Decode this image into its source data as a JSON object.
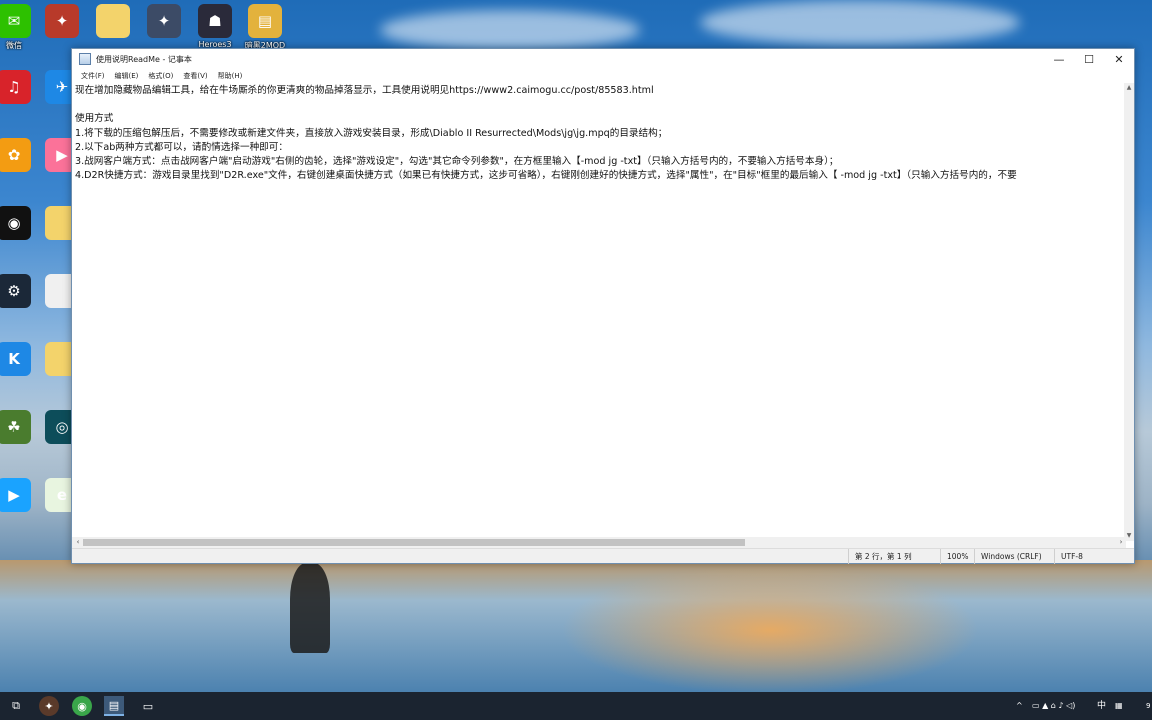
{
  "desktop": {
    "icons": [
      {
        "label": "微信",
        "icon": "wechat-icon",
        "color": "#2dc100",
        "glyph": "✉"
      },
      {
        "label": "",
        "icon": "game-icon",
        "color": "#b83a2a",
        "glyph": "✦"
      },
      {
        "label": "",
        "icon": "folder-icon",
        "color": "#f3d36b",
        "glyph": ""
      },
      {
        "label": "",
        "icon": "game-icon",
        "color": "#3c4b66",
        "glyph": "✦"
      },
      {
        "label": "Heroes3",
        "icon": "game-icon",
        "color": "#2a2a3a",
        "glyph": "☗"
      },
      {
        "label": "暗黑2MOD",
        "icon": "archive-icon",
        "color": "#e3b23c",
        "glyph": "▤"
      },
      {
        "label": "",
        "icon": "netease-music-icon",
        "color": "#d8232a",
        "glyph": "♫"
      },
      {
        "label": "",
        "icon": "app-icon",
        "color": "#1e88e5",
        "glyph": "✈"
      },
      {
        "label": "",
        "icon": "app-icon",
        "color": "#f39c12",
        "glyph": "✿"
      },
      {
        "label": "",
        "icon": "bilibili-icon",
        "color": "#fb7299",
        "glyph": "▶"
      },
      {
        "label": "",
        "icon": "qq-icon",
        "color": "#111",
        "glyph": "◉"
      },
      {
        "label": "",
        "icon": "folder-icon",
        "color": "#f3d36b",
        "glyph": ""
      },
      {
        "label": "",
        "icon": "steam-icon",
        "color": "#1b2838",
        "glyph": "⚙"
      },
      {
        "label": "",
        "icon": "document-icon",
        "color": "#f0f0f0",
        "glyph": ""
      },
      {
        "label": "",
        "icon": "app-icon",
        "color": "#1e88e5",
        "glyph": "K"
      },
      {
        "label": "",
        "icon": "folder-icon",
        "color": "#f3d36b",
        "glyph": ""
      },
      {
        "label": "",
        "icon": "app-icon",
        "color": "#4a7c2e",
        "glyph": "☘"
      },
      {
        "label": "",
        "icon": "app-icon",
        "color": "#0d4d5a",
        "glyph": "◎"
      },
      {
        "label": "",
        "icon": "video-icon",
        "color": "#1aa3ff",
        "glyph": "▶"
      },
      {
        "label": "",
        "icon": "app-icon",
        "color": "#e8f5e0",
        "glyph": "e"
      }
    ]
  },
  "window": {
    "title": "使用说明ReadMe - 记事本",
    "controls": {
      "minimize": "—",
      "maximize": "☐",
      "close": "✕"
    },
    "menu": [
      "文件(F)",
      "编辑(E)",
      "格式(O)",
      "查看(V)",
      "帮助(H)"
    ],
    "lines": [
      "现在增加隐藏物品编辑工具，给在牛场厮杀的你更清爽的物品掉落显示，工具使用说明见https://www2.caimogu.cc/post/85583.html",
      "",
      "使用方式",
      "1.将下载的压缩包解压后，不需要修改或新建文件夹，直接放入游戏安装目录，形成\\Diablo II Resurrected\\Mods\\jg\\jg.mpq的目录结构；",
      "2.以下ab两种方式都可以，请酌情选择一种即可：",
      "3.战网客户端方式：点击战网客户端\"启动游戏\"右侧的齿轮，选择\"游戏设定\"，勾选\"其它命令列参数\"，在方框里输入【-mod jg -txt】（只输入方括号内的，不要输入方括号本身）；",
      "4.D2R快捷方式：游戏目录里找到\"D2R.exe\"文件，右键创建桌面快捷方式（如果已有快捷方式，这步可省略），右键刚创建好的快捷方式，选择\"属性\"，在\"目标\"框里的最后输入【 -mod jg -txt】（只输入方括号内的，不要"
    ],
    "status": {
      "position": "第 2 行，第 1 列",
      "zoom": "100%",
      "line_ending": "Windows (CRLF)",
      "encoding": "UTF-8"
    }
  },
  "taskbar": {
    "items": [
      {
        "name": "task-view-icon",
        "glyph": "⧉"
      },
      {
        "name": "game-icon",
        "glyph": "✦"
      },
      {
        "name": "browser-icon",
        "glyph": "◉"
      },
      {
        "name": "notepad-icon",
        "glyph": "▤"
      },
      {
        "name": "camera-icon",
        "glyph": "▭"
      }
    ],
    "tray": {
      "chevron": "^",
      "ime": "中",
      "clock_partial": "9"
    }
  }
}
